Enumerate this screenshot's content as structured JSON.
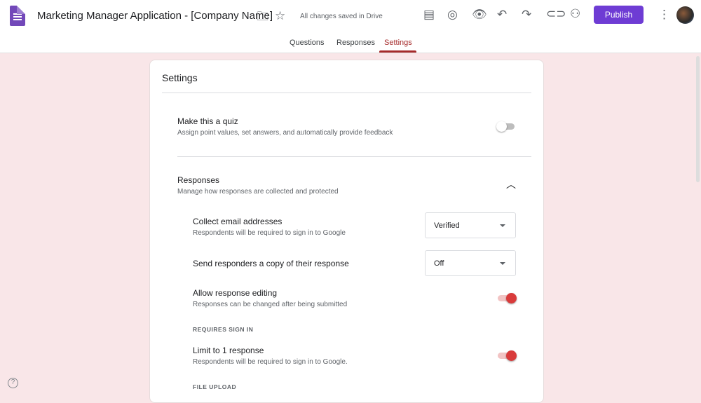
{
  "header": {
    "title": "Marketing Manager Application - [Company Name]",
    "save_status": "All changes saved in Drive",
    "publish_label": "Publish"
  },
  "tabs": [
    {
      "label": "Questions"
    },
    {
      "label": "Responses"
    },
    {
      "label": "Settings",
      "active": true
    }
  ],
  "settings": {
    "title": "Settings",
    "quiz": {
      "title": "Make this a quiz",
      "desc": "Assign point values, set answers, and automatically provide feedback",
      "enabled": false
    },
    "responses": {
      "title": "Responses",
      "desc": "Manage how responses are collected and protected",
      "collect_email": {
        "title": "Collect email addresses",
        "desc": "Respondents will be required to sign in to Google",
        "value": "Verified"
      },
      "send_copy": {
        "title": "Send responders a copy of their response",
        "value": "Off"
      },
      "allow_edit": {
        "title": "Allow response editing",
        "desc": "Responses can be changed after being submitted",
        "enabled": true
      },
      "requires_sign_in": "REQUIRES SIGN IN",
      "limit": {
        "title": "Limit to 1 response",
        "desc": "Respondents will be required to sign in to Google.",
        "enabled": true
      },
      "file_upload": "FILE UPLOAD"
    }
  },
  "help_icon": "?",
  "colors": {
    "accent": "#6e3cd4",
    "toggle_on": "#d93b3b",
    "tab_active": "#a52a2a",
    "background": "#f9e6e8"
  }
}
